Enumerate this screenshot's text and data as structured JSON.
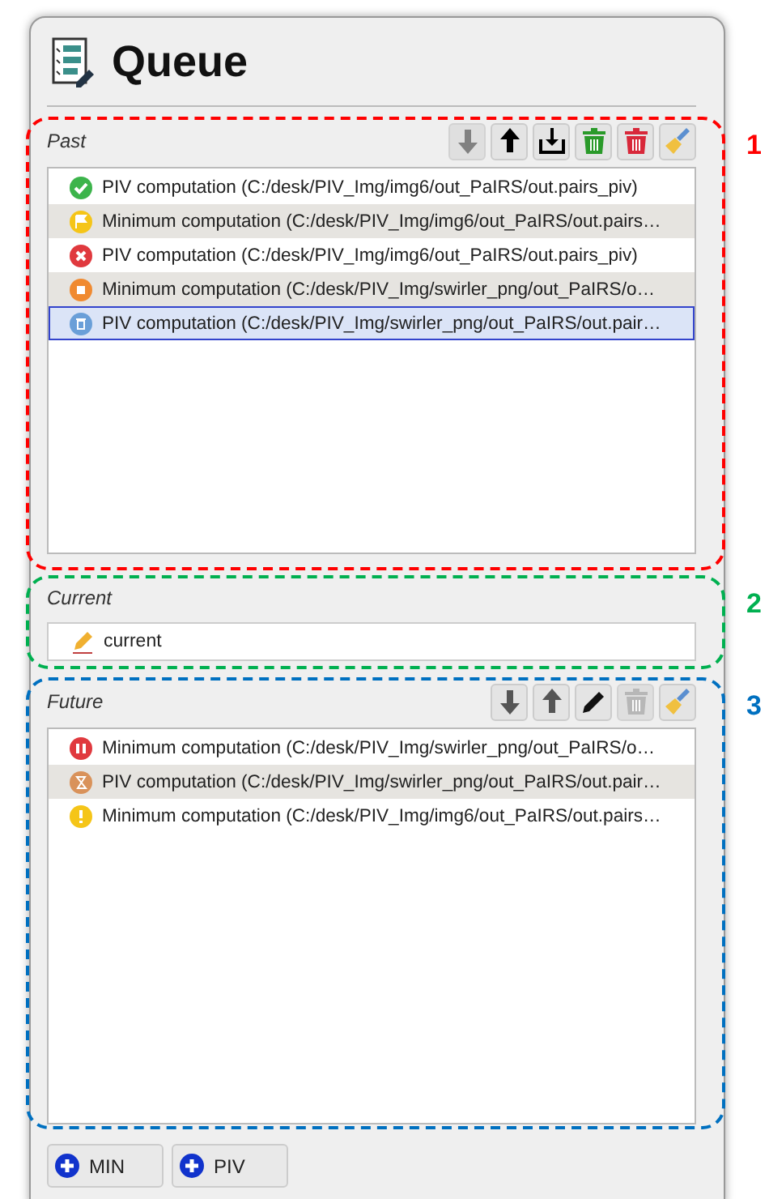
{
  "title": "Queue",
  "past": {
    "label": "Past",
    "tools": [
      {
        "kind": "down",
        "disabled": true
      },
      {
        "kind": "up",
        "disabled": false
      },
      {
        "kind": "export",
        "disabled": false
      },
      {
        "kind": "trash-green",
        "disabled": false
      },
      {
        "kind": "trash-red",
        "disabled": false
      },
      {
        "kind": "broom",
        "disabled": false
      }
    ],
    "items": [
      {
        "kind": "done",
        "text": "PIV computation (C:/desk/PIV_Img/img6/out_PaIRS/out.pairs_piv)",
        "selected": false
      },
      {
        "kind": "flag",
        "text": "Minimum computation (C:/desk/PIV_Img/img6/out_PaIRS/out.pairs…",
        "selected": false
      },
      {
        "kind": "error",
        "text": "PIV computation (C:/desk/PIV_Img/img6/out_PaIRS/out.pairs_piv)",
        "selected": false
      },
      {
        "kind": "stopped",
        "text": "Minimum computation (C:/desk/PIV_Img/swirler_png/out_PaIRS/o…",
        "selected": false
      },
      {
        "kind": "trash",
        "text": "PIV computation (C:/desk/PIV_Img/swirler_png/out_PaIRS/out.pair…",
        "selected": true
      }
    ]
  },
  "current": {
    "label": "Current",
    "value": "current"
  },
  "future": {
    "label": "Future",
    "tools": [
      {
        "kind": "down",
        "disabled": false
      },
      {
        "kind": "up",
        "disabled": false
      },
      {
        "kind": "pencil",
        "disabled": false
      },
      {
        "kind": "trash-gray",
        "disabled": true
      },
      {
        "kind": "broom",
        "disabled": false
      }
    ],
    "items": [
      {
        "kind": "paused",
        "text": "Minimum computation (C:/desk/PIV_Img/swirler_png/out_PaIRS/o…",
        "selected": false
      },
      {
        "kind": "waiting",
        "text": "PIV computation (C:/desk/PIV_Img/swirler_png/out_PaIRS/out.pair…",
        "selected": false
      },
      {
        "kind": "warning",
        "text": "Minimum computation (C:/desk/PIV_Img/img6/out_PaIRS/out.pairs…",
        "selected": false
      }
    ]
  },
  "buttons": [
    "MIN",
    "PIV"
  ],
  "annotations": [
    {
      "label": "1",
      "color": "#ff0000"
    },
    {
      "label": "2",
      "color": "#00b050"
    },
    {
      "label": "3",
      "color": "#0070c0"
    }
  ]
}
